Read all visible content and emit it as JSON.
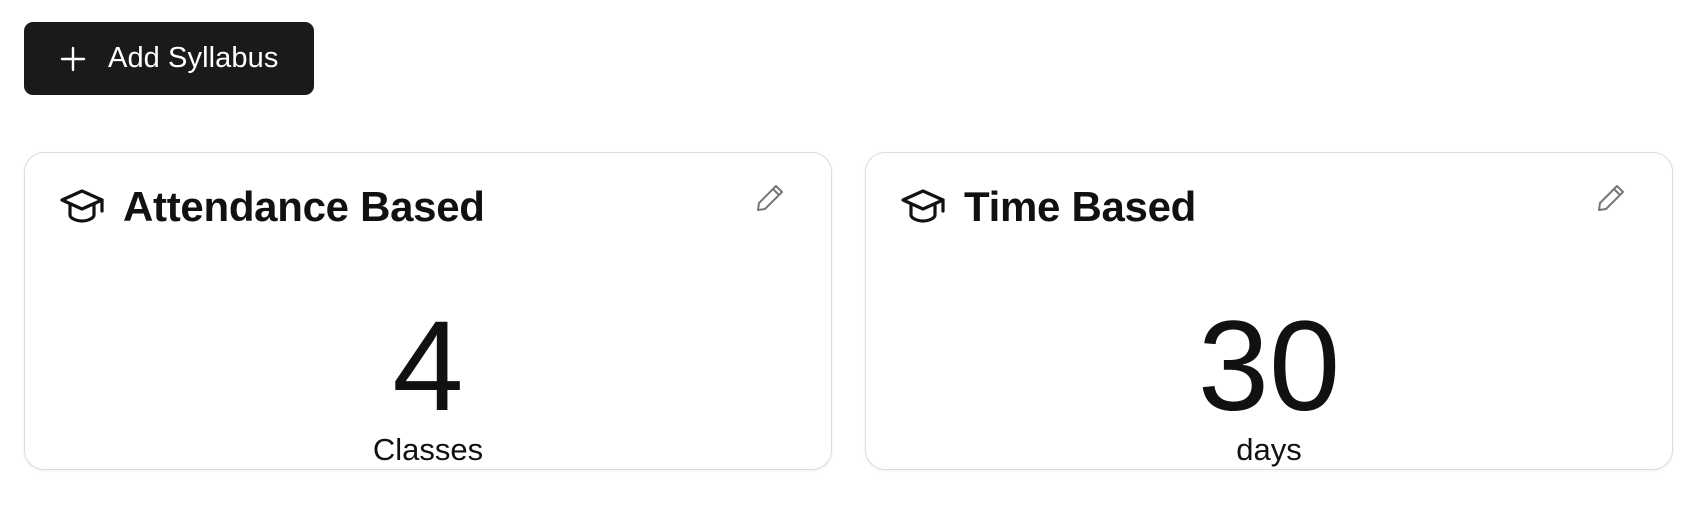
{
  "toolbar": {
    "add_button_label": "Add Syllabus",
    "add_button_icon": "plus-icon"
  },
  "cards": [
    {
      "title": "Attendance Based",
      "icon": "graduation-cap-icon",
      "edit_icon": "pencil-icon",
      "value": "4",
      "unit": "Classes"
    },
    {
      "title": "Time Based",
      "icon": "graduation-cap-icon",
      "edit_icon": "pencil-icon",
      "value": "30",
      "unit": "days"
    }
  ],
  "colors": {
    "button_bg": "#1a1a1a",
    "button_text": "#ffffff",
    "card_border": "#dcdcdc",
    "text": "#111111"
  }
}
